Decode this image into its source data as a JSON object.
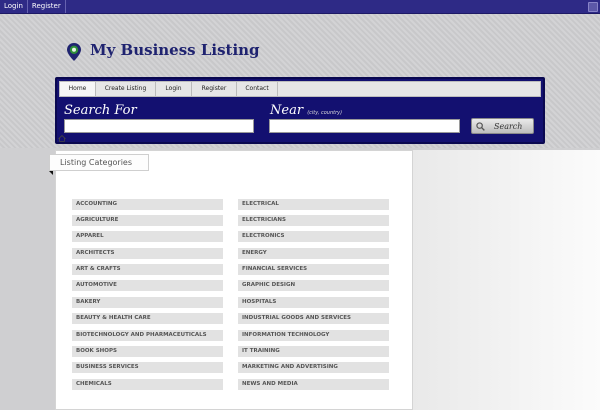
{
  "topbar": {
    "login_label": "Login",
    "register_label": "Register"
  },
  "header": {
    "logo_text": "My Business Listing"
  },
  "nav": {
    "tabs": [
      {
        "label": "Home",
        "active": true
      },
      {
        "label": "Create Listing",
        "active": false
      },
      {
        "label": "Login",
        "active": false
      },
      {
        "label": "Register",
        "active": false
      },
      {
        "label": "Contact",
        "active": false
      }
    ]
  },
  "search": {
    "search_for_label": "Search For",
    "near_label": "Near",
    "near_hint": "(city, country)",
    "search_for_value": "",
    "near_value": "",
    "button_label": "Search"
  },
  "categories": {
    "title": "Listing Categories",
    "left_column": [
      "ACCOUNTING",
      "AGRICULTURE",
      "APPAREL",
      "ARCHITECTS",
      "ART & CRAFTS",
      "AUTOMOTIVE",
      "BAKERY",
      "BEAUTY & HEALTH CARE",
      "BIOTECHNOLOGY AND PHARMACEUTICALS",
      "BOOK SHOPS",
      "BUSINESS SERVICES",
      "CHEMICALS"
    ],
    "right_column": [
      "ELECTRICAL",
      "ELECTRICIANS",
      "ELECTRONICS",
      "ENERGY",
      "FINANCIAL SERVICES",
      "GRAPHIC DESIGN",
      "HOSPITALS",
      "INDUSTRIAL GOODS AND SERVICES",
      "INFORMATION TECHNOLOGY",
      "IT TRAINING",
      "MARKETING AND ADVERTISING",
      "NEWS AND MEDIA"
    ]
  },
  "colors": {
    "topbar": "#2e2a86",
    "nav_panel": "#131070",
    "logo_text": "#1f2370",
    "logo_pin": "#2f8f3a"
  }
}
